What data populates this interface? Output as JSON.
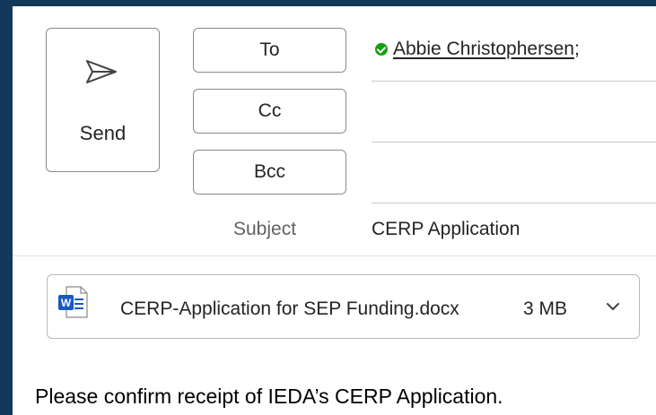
{
  "send": {
    "label": "Send",
    "icon": "paper-plane-icon"
  },
  "recipients": {
    "to_label": "To",
    "cc_label": "Cc",
    "bcc_label": "Bcc",
    "to_value": "Abbie Christophersen",
    "to_separator": ";",
    "cc_value": "",
    "bcc_value": "",
    "presence_color": "#13a10e"
  },
  "subject": {
    "label": "Subject",
    "value": "CERP Application"
  },
  "attachment": {
    "name": "CERP-Application for SEP Funding.docx",
    "size": "3 MB",
    "icon": "word-document-icon"
  },
  "body": {
    "text": "Please confirm receipt of IEDA’s CERP Application."
  },
  "colors": {
    "frame": "#12395a",
    "word_blue": "#185abd"
  }
}
